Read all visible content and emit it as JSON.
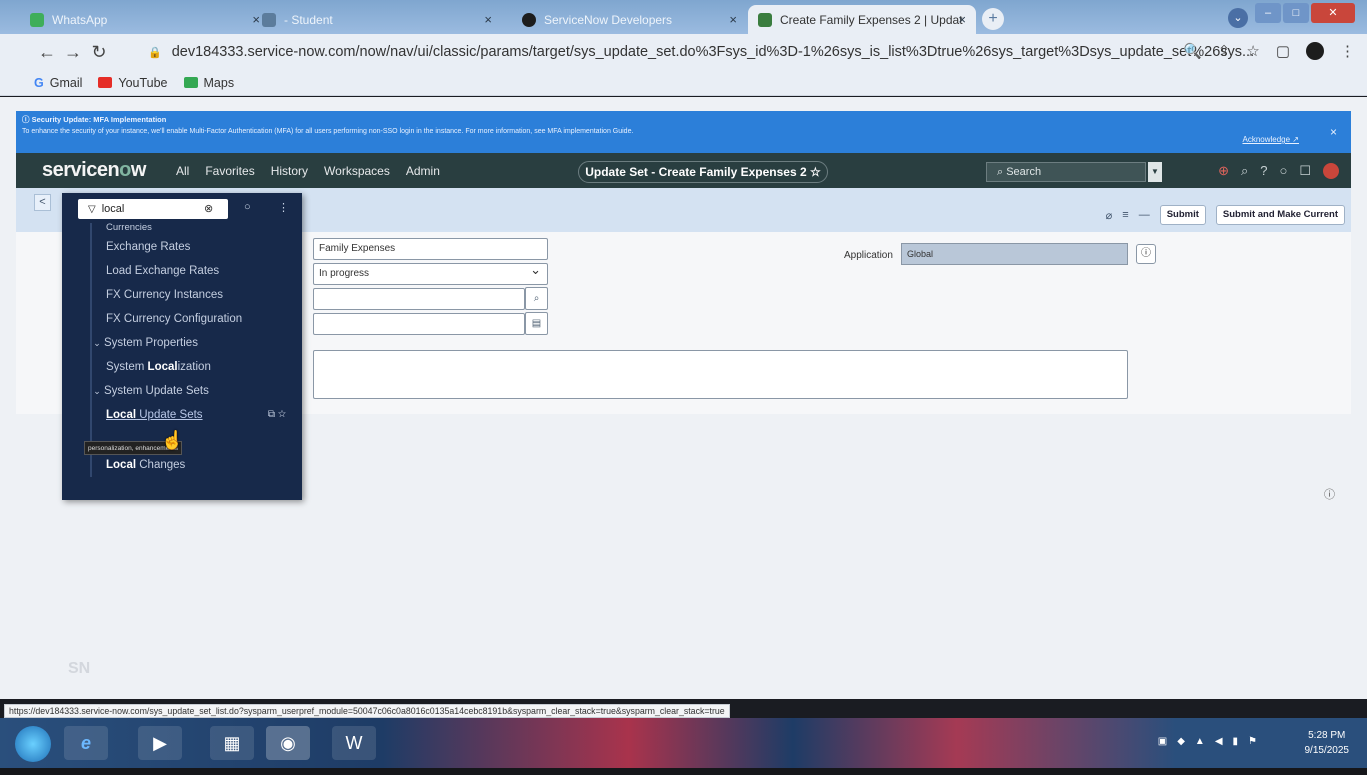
{
  "browser": {
    "tabs": [
      {
        "label": "WhatsApp",
        "close": "×"
      },
      {
        "label": "- Student",
        "close": "×"
      },
      {
        "label": "ServiceNow Developers",
        "close": "×"
      },
      {
        "label": "Create Family Expenses 2 | Updat",
        "close": "×"
      }
    ],
    "new_tab": "+",
    "url": "dev184333.service-now.com/now/nav/ui/classic/params/target/sys_update_set.do%3Fsys_id%3D-1%26sys_is_list%3Dtrue%26sys_target%3Dsys_update_set%26sys...",
    "bookmarks": [
      "Gmail",
      "YouTube",
      "Maps"
    ]
  },
  "banner": {
    "title": "Security Update: MFA Implementation",
    "text": "To enhance the security of your instance, we'll enable Multi-Factor Authentication (MFA) for all users performing non-SSO login in the instance. For more information, see MFA implementation Guide.",
    "acknowledge": "Acknowledge ↗",
    "close": "×"
  },
  "servicenow": {
    "logo_prefix": "servicen",
    "logo_o": "o",
    "logo_suffix": "w",
    "nav": [
      "All",
      "Favorites",
      "History",
      "Workspaces",
      "Admin"
    ],
    "context_pill": "Update Set - Create Family Expenses 2 ☆",
    "search_placeholder": "Search"
  },
  "form": {
    "name": "Family Expenses",
    "state": "In progress",
    "application_label": "Application",
    "application": "Global",
    "submit": "Submit",
    "submit_current": "Submit and Make Current"
  },
  "navigator": {
    "filter": "local",
    "items": [
      {
        "type": "item",
        "pre": "",
        "bold": "",
        "post": "Currencies"
      },
      {
        "type": "item",
        "pre": "",
        "bold": "",
        "post": "Exchange Rates"
      },
      {
        "type": "item",
        "pre": "",
        "bold": "",
        "post": "Load Exchange Rates"
      },
      {
        "type": "item",
        "pre": "",
        "bold": "",
        "post": "FX Currency Instances"
      },
      {
        "type": "item",
        "pre": "",
        "bold": "",
        "post": "FX Currency Configuration"
      },
      {
        "type": "head",
        "pre": "",
        "bold": "",
        "post": "System Properties"
      },
      {
        "type": "item",
        "pre": "System ",
        "bold": "Local",
        "post": "ization"
      },
      {
        "type": "head",
        "pre": "",
        "bold": "",
        "post": "System Update Sets"
      },
      {
        "type": "hl",
        "pre": "",
        "bold": "Local",
        "post": " Update Sets"
      },
      {
        "type": "spacer",
        "pre": "",
        "bold": "",
        "post": ""
      },
      {
        "type": "item",
        "pre": "",
        "bold": "Local",
        "post": " Changes"
      }
    ],
    "tooltip": "personalization, enhancements"
  },
  "watermark": "SN",
  "status_url": "https://dev184333.service-now.com/sys_update_set_list.do?sysparm_userpref_module=50047c06c0a8016c0135a14cebc8191b&sysparm_clear_stack=true&sysparm_clear_stack=true",
  "taskbar": {
    "time": "5:28 PM",
    "date": "9/15/2025"
  }
}
